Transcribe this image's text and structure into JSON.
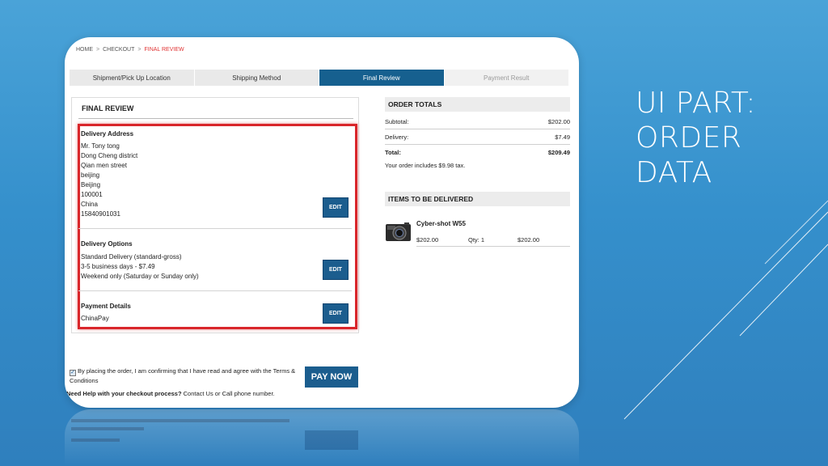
{
  "slide": {
    "title_lines": [
      "UI PART:",
      "ORDER",
      "DATA"
    ]
  },
  "breadcrumb": {
    "home": "HOME",
    "checkout": "CHECKOUT",
    "current": "FINAL REVIEW",
    "sep": ">"
  },
  "steps": [
    {
      "label": "Shipment/Pick Up Location",
      "state": "done"
    },
    {
      "label": "Shipping Method",
      "state": "done"
    },
    {
      "label": "Final Review",
      "state": "active"
    },
    {
      "label": "Payment Result",
      "state": "disabled"
    }
  ],
  "review": {
    "title": "FINAL REVIEW",
    "delivery_address": {
      "label": "Delivery Address",
      "lines": [
        "Mr. Tony tong",
        "Dong Cheng district",
        "Qian men street",
        "beijing",
        "Beijing",
        "100001",
        "China",
        "15840901031"
      ],
      "edit_label": "EDIT"
    },
    "delivery_options": {
      "label": "Delivery Options",
      "lines": [
        "Standard Delivery (standard-gross)",
        "3-5 business days - $7.49",
        "Weekend only (Saturday or Sunday only)"
      ],
      "edit_label": "EDIT"
    },
    "payment_details": {
      "label": "Payment Details",
      "lines": [
        "ChinaPay"
      ],
      "edit_label": "EDIT"
    }
  },
  "terms": {
    "checked": true,
    "text": "By placing the order, I am confirming that I have read and agree with the Terms & Conditions"
  },
  "help": {
    "bold": "Need Help with your checkout process?",
    "rest": " Contact Us or Call phone number."
  },
  "pay_now_label": "PAY NOW",
  "order_totals": {
    "title": "ORDER TOTALS",
    "subtotal_label": "Subtotal:",
    "subtotal": "$202.00",
    "delivery_label": "Delivery:",
    "delivery": "$7.49",
    "total_label": "Total:",
    "total": "$209.49",
    "tax_note": "Your order includes $9.98 tax."
  },
  "items": {
    "title": "ITEMS TO BE DELIVERED",
    "list": [
      {
        "name": "Cyber-shot W55",
        "price": "$202.00",
        "qty": "Qty: 1",
        "line_total": "$202.00"
      }
    ]
  },
  "colors": {
    "accent": "#1b5d8e",
    "highlight": "#d9262b",
    "breadcrumb_current": "#e03333"
  }
}
